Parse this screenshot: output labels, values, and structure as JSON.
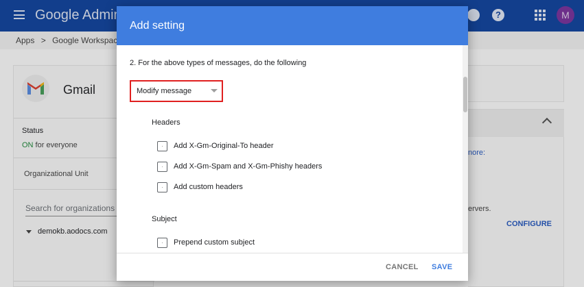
{
  "app": {
    "title": "Google Admin",
    "avatar_letter": "M",
    "help_symbol": "?"
  },
  "breadcrumb": {
    "items": [
      "Apps",
      ">",
      "Google Workspace"
    ]
  },
  "service": {
    "name": "Gmail"
  },
  "status": {
    "label": "Status",
    "on": "ON",
    "suffix": " for everyone"
  },
  "ou": {
    "label": "Organizational Unit",
    "search_placeholder": "Search for organizations",
    "root": "demokb.aodocs.com"
  },
  "right_card": {
    "more_text": "nore:",
    "servers_text": "ervers.",
    "configure_label": "CONFIGURE"
  },
  "dialog": {
    "title": "Add setting",
    "step_text": "2. For the above types of messages, do the following",
    "action_select": {
      "value": "Modify message"
    },
    "sections": {
      "headers": {
        "title": "Headers",
        "items": [
          {
            "label": "Add X-Gm-Original-To header",
            "checked": false
          },
          {
            "label": "Add X-Gm-Spam and X-Gm-Phishy headers",
            "checked": false
          },
          {
            "label": "Add custom headers",
            "checked": false
          }
        ]
      },
      "subject": {
        "title": "Subject",
        "items": [
          {
            "label": "Prepend custom subject",
            "checked": false
          }
        ]
      }
    },
    "buttons": {
      "cancel": "CANCEL",
      "save": "SAVE"
    }
  },
  "colors": {
    "dialog_header": "#3f7ddf",
    "highlight_border": "#e01f1f",
    "topbar_dimmed": "#123e8c",
    "link": "#2450a8",
    "status_on": "#1e7a36"
  }
}
